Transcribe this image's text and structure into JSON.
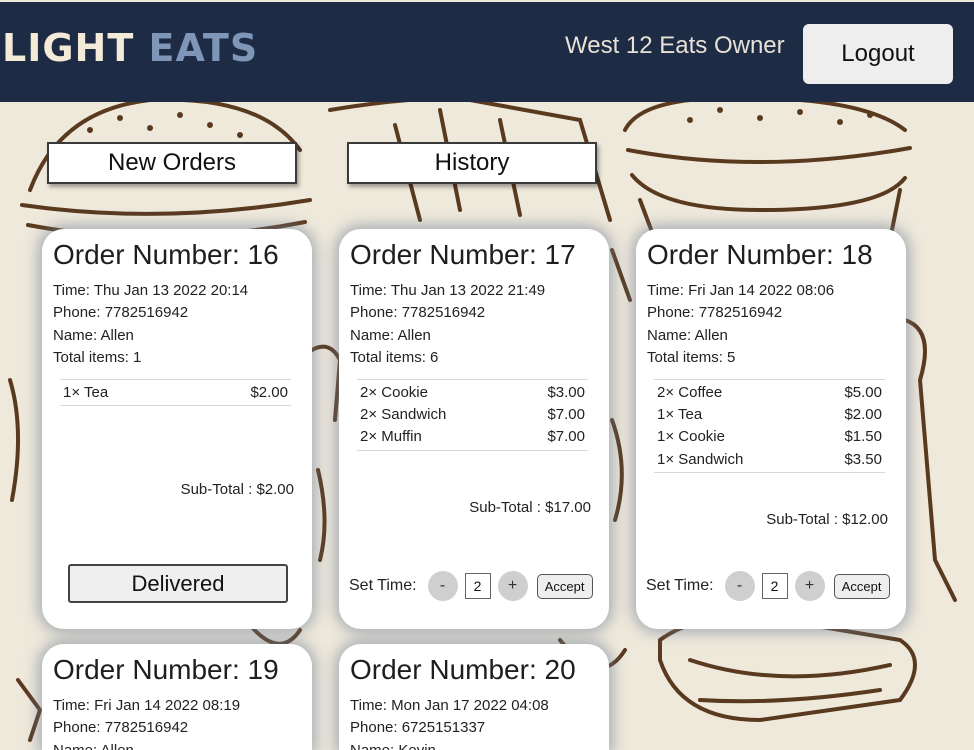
{
  "header": {
    "logo_part1": "LIGHT",
    "logo_part2": "EATS",
    "owner_label": "West 12 Eats Owner",
    "logout_label": "Logout"
  },
  "nav": {
    "new_orders_label": "New Orders",
    "history_label": "History"
  },
  "labels": {
    "time": "Time:",
    "phone": "Phone:",
    "name": "Name:",
    "total_items": "Total items:",
    "subtotal": "Sub-Total :",
    "delivered": "Delivered",
    "set_time": "Set Time:",
    "minus": "-",
    "plus": "+",
    "accept": "Accept"
  },
  "orders": [
    {
      "title": "Order Number: 16",
      "time": "Thu Jan 13 2022 20:14",
      "phone": "7782516942",
      "name": "Allen",
      "total_items": "1",
      "items": [
        {
          "qty": "1×",
          "name": "Tea",
          "price": "$2.00"
        }
      ],
      "subtotal": "$2.00",
      "status": "delivered"
    },
    {
      "title": "Order Number: 17",
      "time": "Thu Jan 13 2022 21:49",
      "phone": "7782516942",
      "name": "Allen",
      "total_items": "6",
      "items": [
        {
          "qty": "2×",
          "name": "Cookie",
          "price": "$3.00"
        },
        {
          "qty": "2×",
          "name": "Sandwich",
          "price": "$7.00"
        },
        {
          "qty": "2×",
          "name": "Muffin",
          "price": "$7.00"
        }
      ],
      "subtotal": "$17.00",
      "set_time_value": "2"
    },
    {
      "title": "Order Number: 18",
      "time": "Fri Jan 14 2022 08:06",
      "phone": "7782516942",
      "name": "Allen",
      "total_items": "5",
      "items": [
        {
          "qty": "2×",
          "name": "Coffee",
          "price": "$5.00"
        },
        {
          "qty": "1×",
          "name": "Tea",
          "price": "$2.00"
        },
        {
          "qty": "1×",
          "name": "Cookie",
          "price": "$1.50"
        },
        {
          "qty": "1×",
          "name": "Sandwich",
          "price": "$3.50"
        }
      ],
      "subtotal": "$12.00",
      "set_time_value": "2"
    },
    {
      "title": "Order Number: 19",
      "time": "Fri Jan 14 2022 08:19",
      "phone": "7782516942",
      "name": "Allen"
    },
    {
      "title": "Order Number: 20",
      "time": "Mon Jan 17 2022 04:08",
      "phone": "6725151337",
      "name": "Kevin"
    }
  ],
  "colors": {
    "header_bg": "#1d2b44",
    "logo_accent": "#7f96b8",
    "page_bg": "#efe9dc",
    "sketch": "#5a3a1f"
  }
}
